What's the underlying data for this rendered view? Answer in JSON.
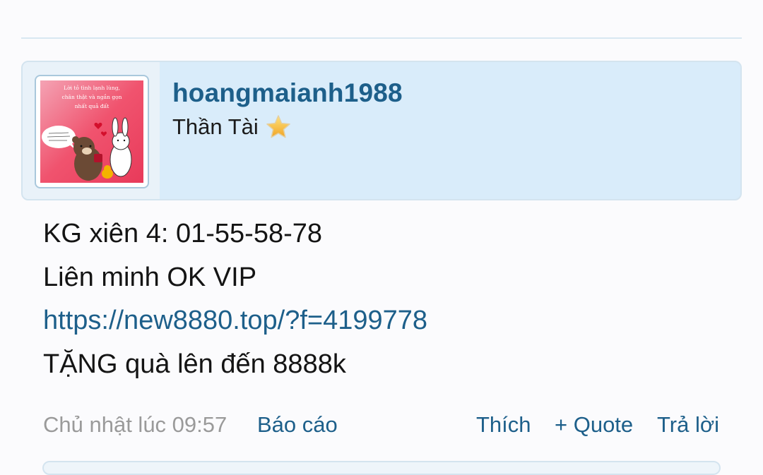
{
  "post": {
    "user": {
      "username": "hoangmaianh1988",
      "title": "Thần Tài",
      "title_icon": "star-icon",
      "avatar": {
        "caption_lines": [
          "Lời tỏ tình lạnh lùng,",
          "chân thật và ngắn gọn",
          "nhất quả đất"
        ]
      }
    },
    "content": {
      "line1": "KG xiên 4: 01-55-58-78",
      "line2": "Liên minh OK VIP",
      "link": "https://new8880.top/?f=4199778",
      "line4": "TẶNG quà lên đến 8888k"
    },
    "footer": {
      "timestamp": "Chủ nhật lúc 09:57",
      "report": "Báo cáo",
      "like": "Thích",
      "quote": "+ Quote",
      "reply": "Trả lời"
    }
  },
  "colors": {
    "accent": "#1d5f8a",
    "user_block_bg": "#d9ecfa",
    "muted_text": "#9a9a9a",
    "avatar_bg": "#f0536e"
  }
}
